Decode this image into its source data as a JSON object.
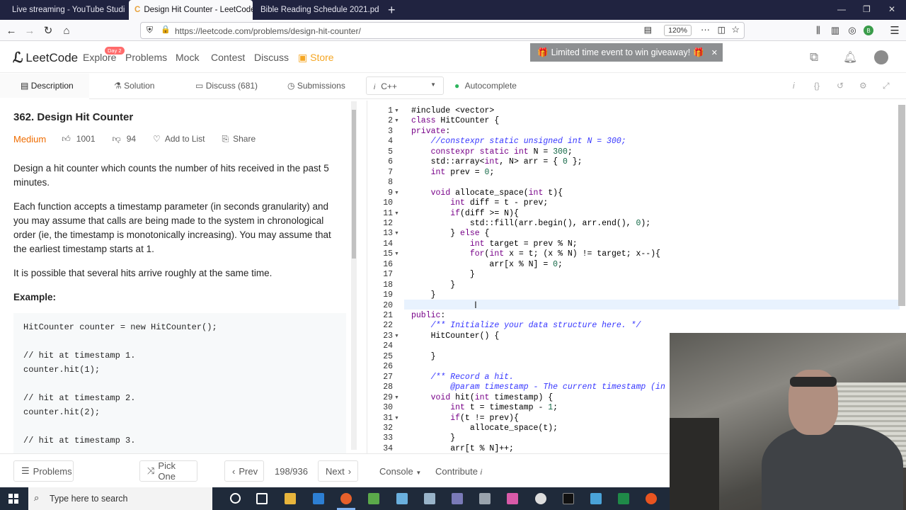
{
  "browser": {
    "tabs": [
      {
        "title": "Live streaming - YouTube Studi",
        "active": false
      },
      {
        "title": "Design Hit Counter - LeetCode",
        "active": true
      },
      {
        "title": "Bible Reading Schedule 2021.pdf",
        "active": false
      }
    ],
    "url": "https://leetcode.com/problems/design-hit-counter/",
    "zoom": "120%"
  },
  "header": {
    "logo": "LeetCode",
    "nav": [
      "Explore",
      "Problems",
      "Mock",
      "Contest",
      "Discuss",
      "Store"
    ],
    "explore_badge": "Day 2",
    "toast": "Limited time event to win giveaway!"
  },
  "panel_tabs": [
    "Description",
    "Solution",
    "Discuss (681)",
    "Submissions"
  ],
  "editor_bar": {
    "language": "C++",
    "autocomplete": "Autocomplete"
  },
  "problem": {
    "title": "362. Design Hit Counter",
    "difficulty": "Medium",
    "likes": "1001",
    "dislikes": "94",
    "add_to_list": "Add to List",
    "share": "Share",
    "paragraphs": [
      "Design a hit counter which counts the number of hits received in the past 5 minutes.",
      "Each function accepts a timestamp parameter (in seconds granularity) and you may assume that calls are being made to the system in chronological order (ie, the timestamp is monotonically increasing). You may assume that the earliest timestamp starts at 1.",
      "It is possible that several hits arrive roughly at the same time."
    ],
    "example_label": "Example:",
    "example_code": "HitCounter counter = new HitCounter();\n\n// hit at timestamp 1.\ncounter.hit(1);\n\n// hit at timestamp 2.\ncounter.hit(2);\n\n// hit at timestamp 3."
  },
  "code_lines": [
    "#include <vector>",
    "class HitCounter {",
    "private:",
    "    //constexpr static unsigned int N = 300;",
    "    constexpr static int N = 300;",
    "    std::array<int, N> arr = { 0 };",
    "    int prev = 0;",
    "",
    "    void allocate_space(int t){",
    "        int diff = t - prev;",
    "        if(diff >= N){",
    "            std::fill(arr.begin(), arr.end(), 0);",
    "        } else {",
    "            int target = prev % N;",
    "            for(int x = t; (x % N) != target; x--){",
    "                arr[x % N] = 0;",
    "            }",
    "        }",
    "    }",
    "",
    "public:",
    "    /** Initialize your data structure here. */",
    "    HitCounter() {",
    "",
    "    }",
    "",
    "    /** Record a hit.",
    "        @param timestamp - The current timestamp (in s",
    "    void hit(int timestamp) {",
    "        int t = timestamp - 1;",
    "        if(t != prev){",
    "            allocate_space(t);",
    "        }",
    "        arr[t % N]++;"
  ],
  "fold_lines": [
    1,
    2,
    9,
    11,
    13,
    15,
    23,
    29,
    31
  ],
  "bottom": {
    "problems": "Problems",
    "pick_one": "Pick One",
    "prev": "Prev",
    "counter": "198/936",
    "next": "Next",
    "console": "Console",
    "contribute": "Contribute"
  },
  "taskbar": {
    "search_placeholder": "Type here to search"
  }
}
